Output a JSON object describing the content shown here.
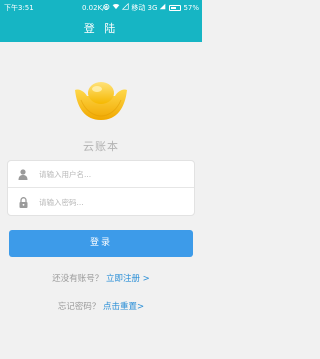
{
  "status_bar": {
    "time": "下午3:51",
    "speed": "0.02K/s",
    "carrier": "移动 3G",
    "battery": "57%",
    "battery_level": 0.57
  },
  "header": {
    "title": "登 陆"
  },
  "app": {
    "name": "云账本"
  },
  "form": {
    "username_placeholder": "请输入用户名...",
    "password_placeholder": "请输入密码..."
  },
  "login_button": "登录",
  "register": {
    "prompt": "还没有账号？",
    "link": "立即注册 >"
  },
  "reset": {
    "prompt": "忘记密码？",
    "link": "点击重置>"
  },
  "colors": {
    "header_bg": "#16b5c4",
    "button_bg": "#3d9be9",
    "link": "#2b8fd7",
    "logo_gold": "#f5b800"
  }
}
